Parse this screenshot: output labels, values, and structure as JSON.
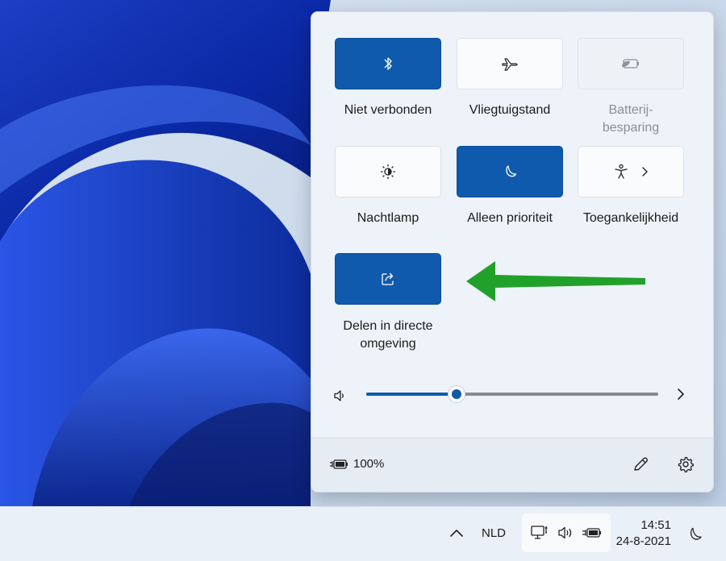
{
  "quick_settings": {
    "tiles": [
      {
        "label": "Niet verbonden",
        "icon": "bluetooth-icon",
        "state": "on"
      },
      {
        "label": "Vliegtuigstand",
        "icon": "airplane-icon",
        "state": "off"
      },
      {
        "label": "Batterij-\nbesparing",
        "icon": "battery-saver-icon",
        "state": "disabled"
      },
      {
        "label": "Nachtlamp",
        "icon": "brightness-icon",
        "state": "off"
      },
      {
        "label": "Alleen prioriteit",
        "icon": "moon-icon",
        "state": "on"
      },
      {
        "label": "Toegankelijkheid",
        "icon": "accessibility-icon",
        "state": "off"
      },
      {
        "label": "Delen in directe\nomgeving",
        "icon": "share-icon",
        "state": "on"
      }
    ],
    "volume": {
      "level": 0.31
    },
    "battery": {
      "percent_text": "100%"
    }
  },
  "taskbar": {
    "language": "NLD",
    "time": "14:51",
    "date": "24-8-2021"
  },
  "colors": {
    "accent": "#0f5aad",
    "arrow": "#22a12a"
  }
}
